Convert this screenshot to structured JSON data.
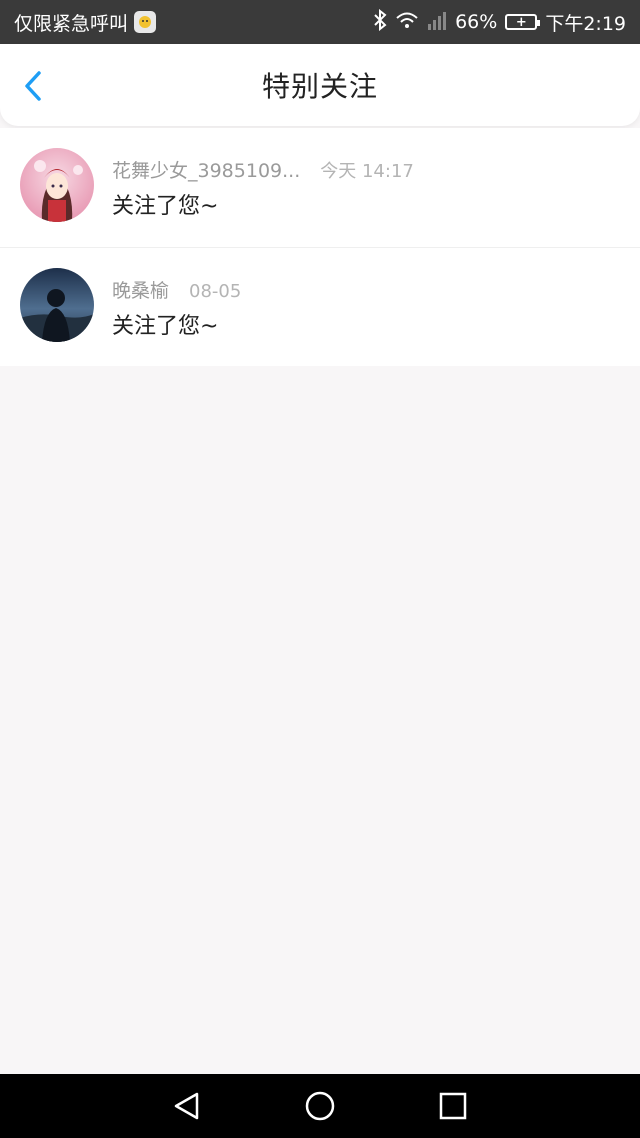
{
  "status_bar": {
    "carrier_text": "仅限紧急呼叫",
    "battery_percent": "66%",
    "time": "下午2:19"
  },
  "nav": {
    "title": "特别关注"
  },
  "notifications": [
    {
      "username": "花舞少女_3985109...",
      "time": "今天 14:17",
      "message": "关注了您~"
    },
    {
      "username": "晚桑榆",
      "time": "08-05",
      "message": "关注了您~"
    }
  ],
  "colors": {
    "accent": "#1e9ef5",
    "status_bar_bg": "#3a3a3a",
    "page_bg": "#f8f6f7"
  },
  "icons": [
    "notification-app-icon",
    "bluetooth-icon",
    "wifi-icon",
    "signal-icon",
    "battery-icon",
    "back-chevron-icon",
    "nav-back-icon",
    "nav-home-icon",
    "nav-recents-icon"
  ]
}
